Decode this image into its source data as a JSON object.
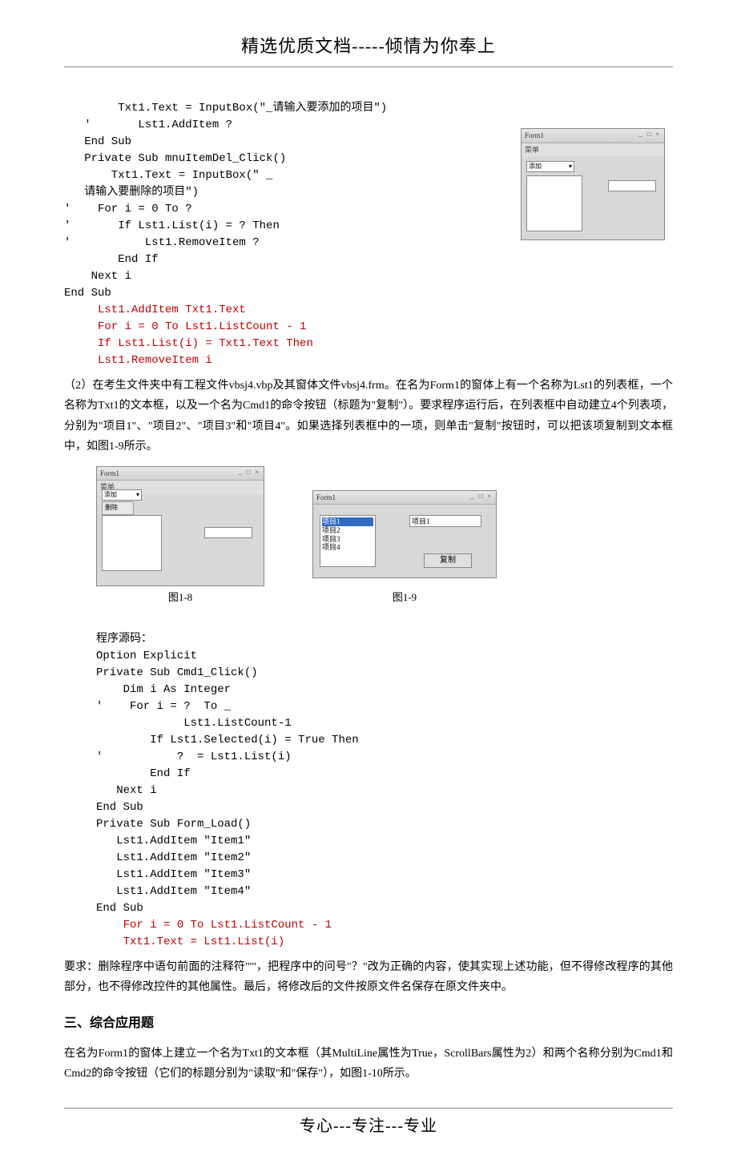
{
  "header": {
    "title": "精选优质文档-----倾情为你奉上"
  },
  "footer": {
    "title": "专心---专注---专业"
  },
  "code1": {
    "l1": "        Txt1.Text = InputBox(\"_请输入要添加的项目\")",
    "l2": "   '       Lst1.AddItem ?",
    "l3": "   End Sub",
    "l4": "   Private Sub mnuItemDel_Click()",
    "l5": "       Txt1.Text = InputBox(\" _",
    "l6": "   请输入要删除的项目\")",
    "l7": "'    For i = 0 To ?",
    "l8": "'       If Lst1.List(i) = ? Then",
    "l9": "'           Lst1.RemoveItem ?",
    "l10": "        End If",
    "l11": "    Next i",
    "l12": "End Sub",
    "r1": "     Lst1.AddItem Txt1.Text",
    "r2": "     For i = 0 To Lst1.ListCount - 1",
    "r3": "     If Lst1.List(i) = Txt1.Text Then",
    "r4": "     Lst1.RemoveItem i"
  },
  "para2": "（2）在考生文件夹中有工程文件vbsj4.vbp及其窗体文件vbsj4.frm。在名为Form1的窗体上有一个名称为Lst1的列表框，一个名称为Txt1的文本框，以及一个名为Cmd1的命令按钮（标题为\"复制\"）。要求程序运行后，在列表框中自动建立4个列表项，分别为\"项目1\"、\"项目2\"、\"项目3\"和\"项目4\"。如果选择列表框中的一项，则单击\"复制\"按钮时，可以把该项复制到文本框中，如图1-9所示。",
  "figcap": {
    "c1": "图1-8",
    "c2": "图1-9"
  },
  "fig2": {
    "win_title": "Form1",
    "items": [
      "项目1",
      "项目2",
      "项目3",
      "项目4"
    ],
    "tf": "项目1",
    "btn": "复制"
  },
  "code2": {
    "l0": "程序源码：",
    "l1": "Option Explicit",
    "l2": "Private Sub Cmd1_Click()",
    "l3": "    Dim i As Integer",
    "l4": "'    For i = ?  To _",
    "l5": "             Lst1.ListCount-1",
    "l6": "        If Lst1.Selected(i) = True Then",
    "l7": "'           ?  = Lst1.List(i)",
    "l8": "        End If",
    "l9": "   Next i",
    "l10": "End Sub",
    "l11": "Private Sub Form_Load()",
    "l12": "   Lst1.AddItem \"Item1\"",
    "l13": "   Lst1.AddItem \"Item2\"",
    "l14": "   Lst1.AddItem \"Item3\"",
    "l15": "   Lst1.AddItem \"Item4\"",
    "l16": "End Sub",
    "r1": "    For i = 0 To Lst1.ListCount - 1",
    "r2": "    Txt1.Text = Lst1.List(i)"
  },
  "para3": "    要求：删除程序中语句前面的注释符\"'\"，把程序中的问号\"？\"改为正确的内容，使其实现上述功能，但不得修改程序的其他部分，也不得修改控件的其他属性。最后，将修改后的文件按原文件名保存在原文件夹中。",
  "section3": "三、综合应用题",
  "para4": "在名为Form1的窗体上建立一个名为Txt1的文本框（其MultiLine属性为True，ScrollBars属性为2）和两个名称分别为Cmd1和Cmd2的命令按钮（它们的标题分别为\"读取\"和\"保存\"），如图1-10所示。"
}
